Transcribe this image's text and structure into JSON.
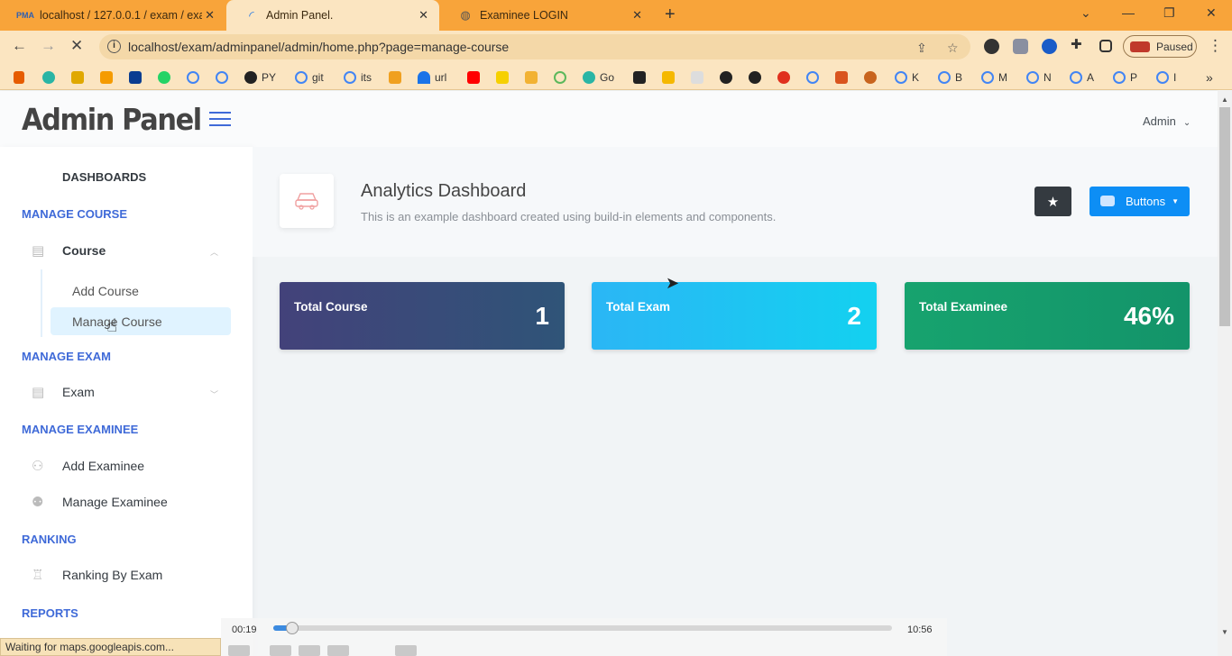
{
  "browser": {
    "tabs": [
      {
        "title": "localhost / 127.0.0.1 / exam / exa",
        "favicon": "phpmyadmin-icon",
        "active": false
      },
      {
        "title": "Admin Panel.",
        "favicon": "loading-spinner-icon",
        "active": true
      },
      {
        "title": "Examinee LOGIN",
        "favicon": "globe-icon",
        "active": false
      }
    ],
    "url": "localhost/exam/adminpanel/admin/home.php?page=manage-course",
    "profile_label": "Paused",
    "bookmarks": [
      "PY",
      "git",
      "its",
      "url",
      "Go",
      "K",
      "B",
      "M",
      "N",
      "A",
      "P",
      "I"
    ],
    "status_text": "Waiting for maps.googleapis.com..."
  },
  "header": {
    "logo": "Admin Panel",
    "user": "Admin"
  },
  "sidebar": {
    "sections": [
      {
        "heading": "DASHBOARDS"
      },
      {
        "heading": "MANAGE COURSE"
      },
      {
        "heading": "MANAGE EXAM"
      },
      {
        "heading": "MANAGE EXAMINEE"
      },
      {
        "heading": "RANKING"
      },
      {
        "heading": "REPORTS"
      }
    ],
    "course": {
      "label": "Course",
      "sub": [
        "Add Course",
        "Manage Course"
      ]
    },
    "exam": {
      "label": "Exam"
    },
    "examinee": {
      "add": "Add Examinee",
      "manage": "Manage Examinee"
    },
    "ranking": {
      "label": "Ranking By Exam"
    }
  },
  "main": {
    "title": "Analytics Dashboard",
    "subtitle": "This is an example dashboard created using build-in elements and components.",
    "buttons_label": "Buttons",
    "cards": [
      {
        "label": "Total Course",
        "value": "1",
        "color": "#3b4a78"
      },
      {
        "label": "Total Exam",
        "value": "2",
        "color": "#20c0f3"
      },
      {
        "label": "Total Examinee",
        "value": "46%",
        "color": "#16a06e"
      }
    ]
  },
  "video": {
    "elapsed": "00:19",
    "total": "10:56",
    "progress": 0.029
  },
  "colors": {
    "accent": "#3f6ad8",
    "tabstrip": "#f8a43a"
  }
}
